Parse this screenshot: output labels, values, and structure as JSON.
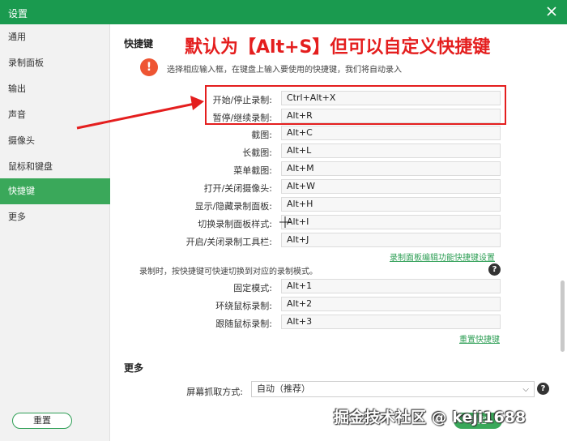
{
  "window": {
    "title": "设置"
  },
  "sidebar": {
    "items": [
      {
        "label": "通用"
      },
      {
        "label": "录制面板"
      },
      {
        "label": "输出"
      },
      {
        "label": "声音"
      },
      {
        "label": "摄像头"
      },
      {
        "label": "鼠标和键盘"
      },
      {
        "label": "快捷键",
        "active": true
      },
      {
        "label": "更多"
      }
    ]
  },
  "shortcuts": {
    "title": "快捷键",
    "hint_icon": "!",
    "hint": "选择相应输入框，在键盘上输入要使用的快捷键，我们将自动录入",
    "rows": [
      {
        "label": "开始/停止录制:",
        "value": "Ctrl+Alt+X"
      },
      {
        "label": "暂停/继续录制:",
        "value": "Alt+R"
      },
      {
        "label": "截图:",
        "value": "Alt+C"
      },
      {
        "label": "长截图:",
        "value": "Alt+L"
      },
      {
        "label": "菜单截图:",
        "value": "Alt+M"
      },
      {
        "label": "打开/关闭摄像头:",
        "value": "Alt+W"
      },
      {
        "label": "显示/隐藏录制面板:",
        "value": "Alt+H"
      },
      {
        "label": "切换录制面板样式:",
        "value": "Alt+I"
      },
      {
        "label": "开启/关闭录制工具栏:",
        "value": "Alt+J"
      }
    ],
    "panel_link": "录制面板编辑功能快捷键设置",
    "mode_note": "录制时，按快捷键可快速切换到对应的录制模式。",
    "mode_rows": [
      {
        "label": "固定模式:",
        "value": "Alt+1"
      },
      {
        "label": "环绕鼠标录制:",
        "value": "Alt+2"
      },
      {
        "label": "跟随鼠标录制:",
        "value": "Alt+3"
      }
    ],
    "reset_link": "重置快捷键"
  },
  "more": {
    "title": "更多",
    "capture_label": "屏幕抓取方式:",
    "capture_value": "自动（推荐）"
  },
  "footer": {
    "reset_button": "重置",
    "ok_button": "确定"
  },
  "annotation": {
    "text": "默认为【Alt+S】但可以自定义快捷键"
  },
  "watermark": "掘金技术社区 @ keji1688",
  "colors": {
    "accent": "#3aa85a",
    "titlebar": "#1a9a4f",
    "annotation": "#e41e1e"
  },
  "icons": {
    "close": "close-icon",
    "hint": "warning-icon",
    "help": "question-icon",
    "dropdown": "chevron-down-icon"
  }
}
